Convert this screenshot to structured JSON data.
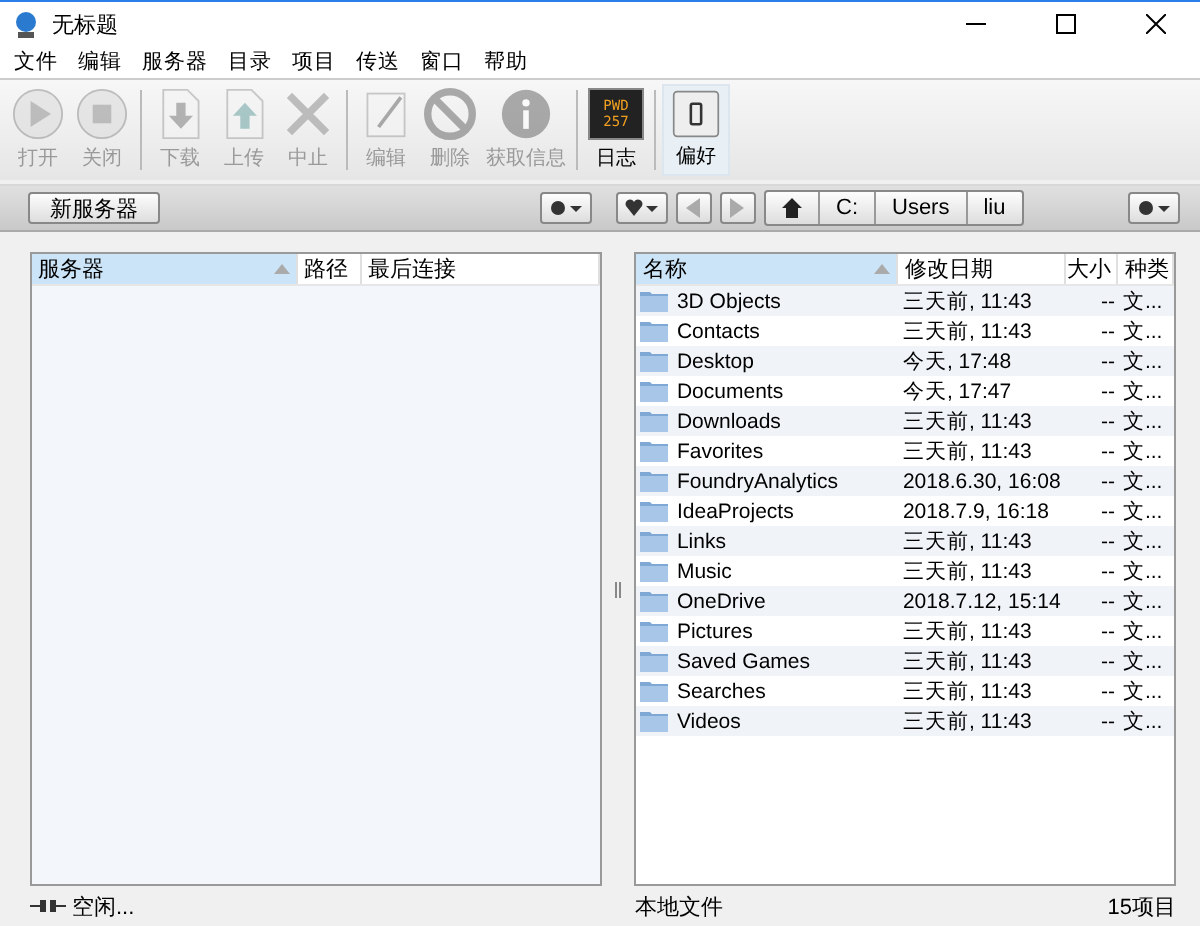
{
  "window": {
    "title": "无标题"
  },
  "menu": [
    "文件",
    "编辑",
    "服务器",
    "目录",
    "项目",
    "传送",
    "窗口",
    "帮助"
  ],
  "toolbar": [
    {
      "kind": "open",
      "label": "打开",
      "disabled": true,
      "selected": false
    },
    {
      "kind": "close",
      "label": "关闭",
      "disabled": true,
      "selected": false
    },
    {
      "kind": "sep"
    },
    {
      "kind": "download",
      "label": "下载",
      "disabled": true,
      "selected": false
    },
    {
      "kind": "upload",
      "label": "上传",
      "disabled": true,
      "selected": false
    },
    {
      "kind": "stop",
      "label": "中止",
      "disabled": true,
      "selected": false
    },
    {
      "kind": "sep"
    },
    {
      "kind": "edit",
      "label": "编辑",
      "disabled": true,
      "selected": false
    },
    {
      "kind": "delete",
      "label": "删除",
      "disabled": true,
      "selected": false
    },
    {
      "kind": "info",
      "label": "获取信息",
      "disabled": true,
      "selected": false
    },
    {
      "kind": "sep"
    },
    {
      "kind": "log",
      "label": "日志",
      "disabled": false,
      "selected": false,
      "badge": [
        "PWD",
        "257"
      ]
    },
    {
      "kind": "sep"
    },
    {
      "kind": "prefs",
      "label": "偏好",
      "disabled": false,
      "selected": true
    }
  ],
  "left": {
    "new_server_button": "新服务器",
    "columns": [
      "服务器",
      "路径",
      "最后连接"
    ],
    "status": "空闲..."
  },
  "right": {
    "path": [
      "C:",
      "Users",
      "liu"
    ],
    "columns": [
      "名称",
      "修改日期",
      "大小",
      "种类"
    ],
    "rows": [
      [
        "3D Objects",
        "三天前, 11:43",
        "--",
        "文..."
      ],
      [
        "Contacts",
        "三天前, 11:43",
        "--",
        "文..."
      ],
      [
        "Desktop",
        "今天, 17:48",
        "--",
        "文..."
      ],
      [
        "Documents",
        "今天, 17:47",
        "--",
        "文..."
      ],
      [
        "Downloads",
        "三天前, 11:43",
        "--",
        "文..."
      ],
      [
        "Favorites",
        "三天前, 11:43",
        "--",
        "文..."
      ],
      [
        "FoundryAnalytics",
        "2018.6.30, 16:08",
        "--",
        "文..."
      ],
      [
        "IdeaProjects",
        "2018.7.9, 16:18",
        "--",
        "文..."
      ],
      [
        "Links",
        "三天前, 11:43",
        "--",
        "文..."
      ],
      [
        "Music",
        "三天前, 11:43",
        "--",
        "文..."
      ],
      [
        "OneDrive",
        "2018.7.12, 15:14",
        "--",
        "文..."
      ],
      [
        "Pictures",
        "三天前, 11:43",
        "--",
        "文..."
      ],
      [
        "Saved Games",
        "三天前, 11:43",
        "--",
        "文..."
      ],
      [
        "Searches",
        "三天前, 11:43",
        "--",
        "文..."
      ],
      [
        "Videos",
        "三天前, 11:43",
        "--",
        "文..."
      ]
    ],
    "status": "本地文件",
    "count": "15项目"
  }
}
